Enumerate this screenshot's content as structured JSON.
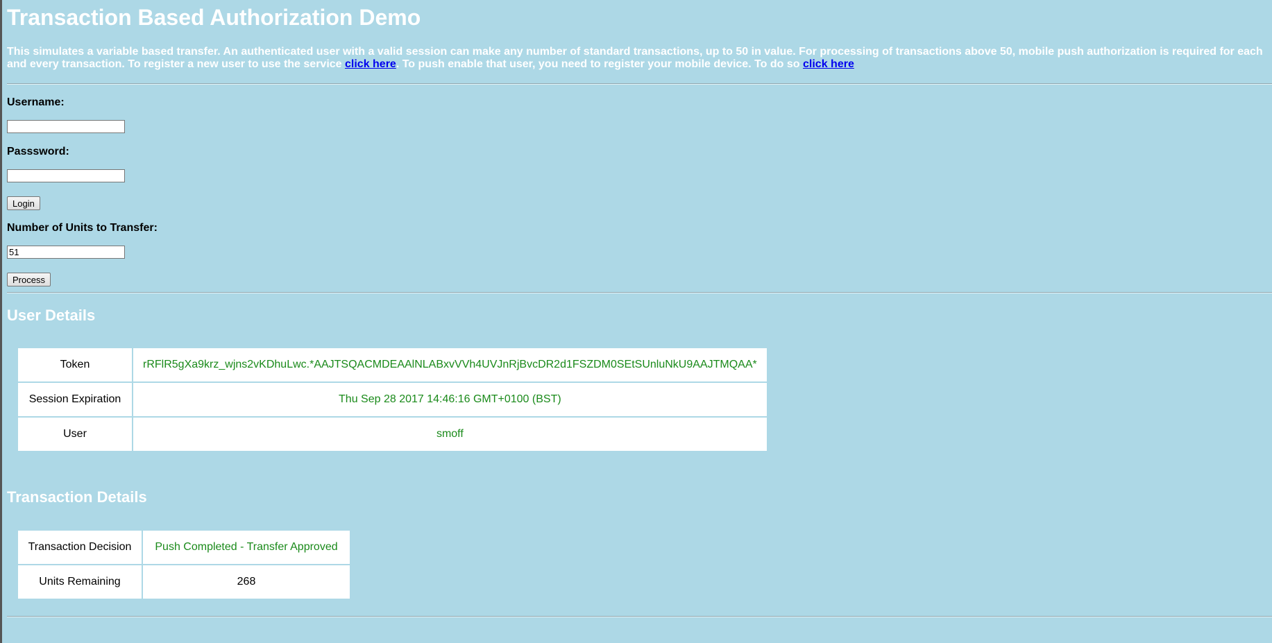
{
  "page": {
    "title": "Transaction Based Authorization Demo",
    "intro": {
      "text_1": "This simulates a variable based transfer. An authenticated user with a valid session can make any number of standard transactions, up to 50 in value. For processing of transactions above 50, mobile push authorization is required for each and every transaction. To register a new user to use the service ",
      "link_1": "click here",
      "text_2": ". To push enable that user, you need to register your mobile device. To do so ",
      "link_2": "click here"
    }
  },
  "login_form": {
    "username_label": "Username:",
    "username_value": "",
    "password_label": "Passsword:",
    "password_value": "",
    "login_button": "Login"
  },
  "transfer_form": {
    "units_label": "Number of Units to Transfer:",
    "units_value": "51",
    "process_button": "Process"
  },
  "user_details": {
    "heading": "User Details",
    "rows": [
      {
        "key": "Token",
        "value": "rRFlR5gXa9krz_wjns2vKDhuLwc.*AAJTSQACMDEAAlNLABxvVVh4UVJnRjBvcDR2d1FSZDM0SEtSUnluNkU9AAJTMQAA*"
      },
      {
        "key": "Session Expiration",
        "value": "Thu Sep 28 2017 14:46:16 GMT+0100 (BST)"
      },
      {
        "key": "User",
        "value": "smoff"
      }
    ]
  },
  "transaction_details": {
    "heading": "Transaction Details",
    "rows": [
      {
        "key": "Transaction Decision",
        "value": "Push Completed - Transfer Approved"
      },
      {
        "key": "Units Remaining",
        "value": "268"
      }
    ]
  },
  "colors": {
    "background": "#add8e6",
    "heading_text": "#ffffff",
    "link": "#0000ee",
    "value_green": "#1a8a1a"
  }
}
